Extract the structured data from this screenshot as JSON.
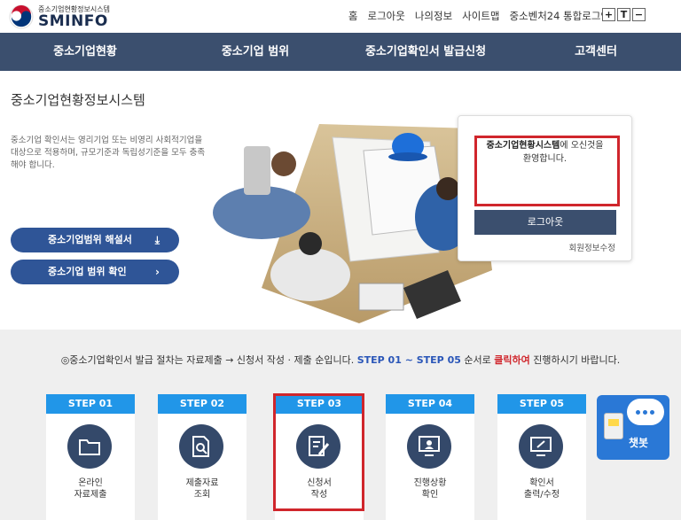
{
  "header": {
    "logo_sub": "중소기업현황정보시스템",
    "logo_main": "SMINFO",
    "nav": [
      "홈",
      "로그아웃",
      "나의정보",
      "사이트맵",
      "중소벤처24 통합로그인"
    ],
    "font_controls": [
      "+",
      "T",
      "−"
    ]
  },
  "mainnav": [
    "중소기업현황",
    "중소기업 범위",
    "중소기업확인서 발급신청",
    "고객센터"
  ],
  "hero": {
    "title": "중소기업현황정보시스템",
    "desc": "중소기업 확인서는 영리기업 또는 비영리 사회적기업을 대상으로 적용하며, 규모기준과 독립성기준을 모두 충족해야 합니다.",
    "btn1": "중소기업범위 해설서",
    "btn2": "중소기업 범위 확인"
  },
  "login": {
    "welcome_bold": "중소기업현황시스템",
    "welcome_rest": "에 오신것을",
    "welcome_line2": "환영합니다.",
    "logout": "로그아웃",
    "edit": "회원정보수정"
  },
  "guide": {
    "part1": "◎중소기업확인서 발급 절차는 자료제출 → 신청서 작성 · 제출 순입니다. ",
    "part2": "STEP 01 ~ STEP 05",
    "part3": " 순서로 ",
    "part4": "클릭하여",
    "part5": " 진행하시기 바랍니다."
  },
  "steps": [
    {
      "head": "STEP 01",
      "label": "온라인\n자료제출"
    },
    {
      "head": "STEP 02",
      "label": "제출자료\n조회"
    },
    {
      "head": "STEP 03",
      "label": "신청서\n작성"
    },
    {
      "head": "STEP 04",
      "label": "진행상황\n확인"
    },
    {
      "head": "STEP 05",
      "label": "확인서\n출력/수정"
    }
  ],
  "chatbot": "챗봇",
  "colors": {
    "nav": "#3b4f6e",
    "step_head": "#2196e8",
    "highlight": "#d0262c",
    "button": "#2f5597"
  }
}
